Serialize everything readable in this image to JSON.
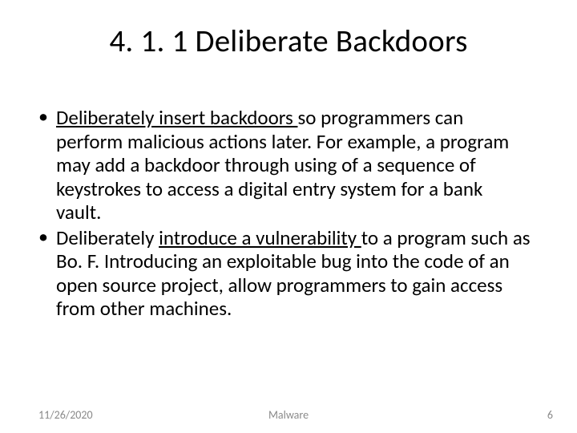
{
  "title": "4. 1. 1 Deliberate Backdoors",
  "bullets": [
    {
      "lead_underlined": "Deliberately insert backdoors ",
      "rest": "so programmers can perform malicious actions later. For example, a program may add a backdoor through using of a sequence of keystrokes to access a digital entry system for a bank vault."
    },
    {
      "prefix": "Deliberately ",
      "mid_underlined": "introduce a vulnerability ",
      "rest": "to a program such as Bo. F.  Introducing an exploitable bug into the code of an open source project, allow programmers to gain access from other machines."
    }
  ],
  "footer": {
    "date": "11/26/2020",
    "center": "Malware",
    "page": "6"
  }
}
